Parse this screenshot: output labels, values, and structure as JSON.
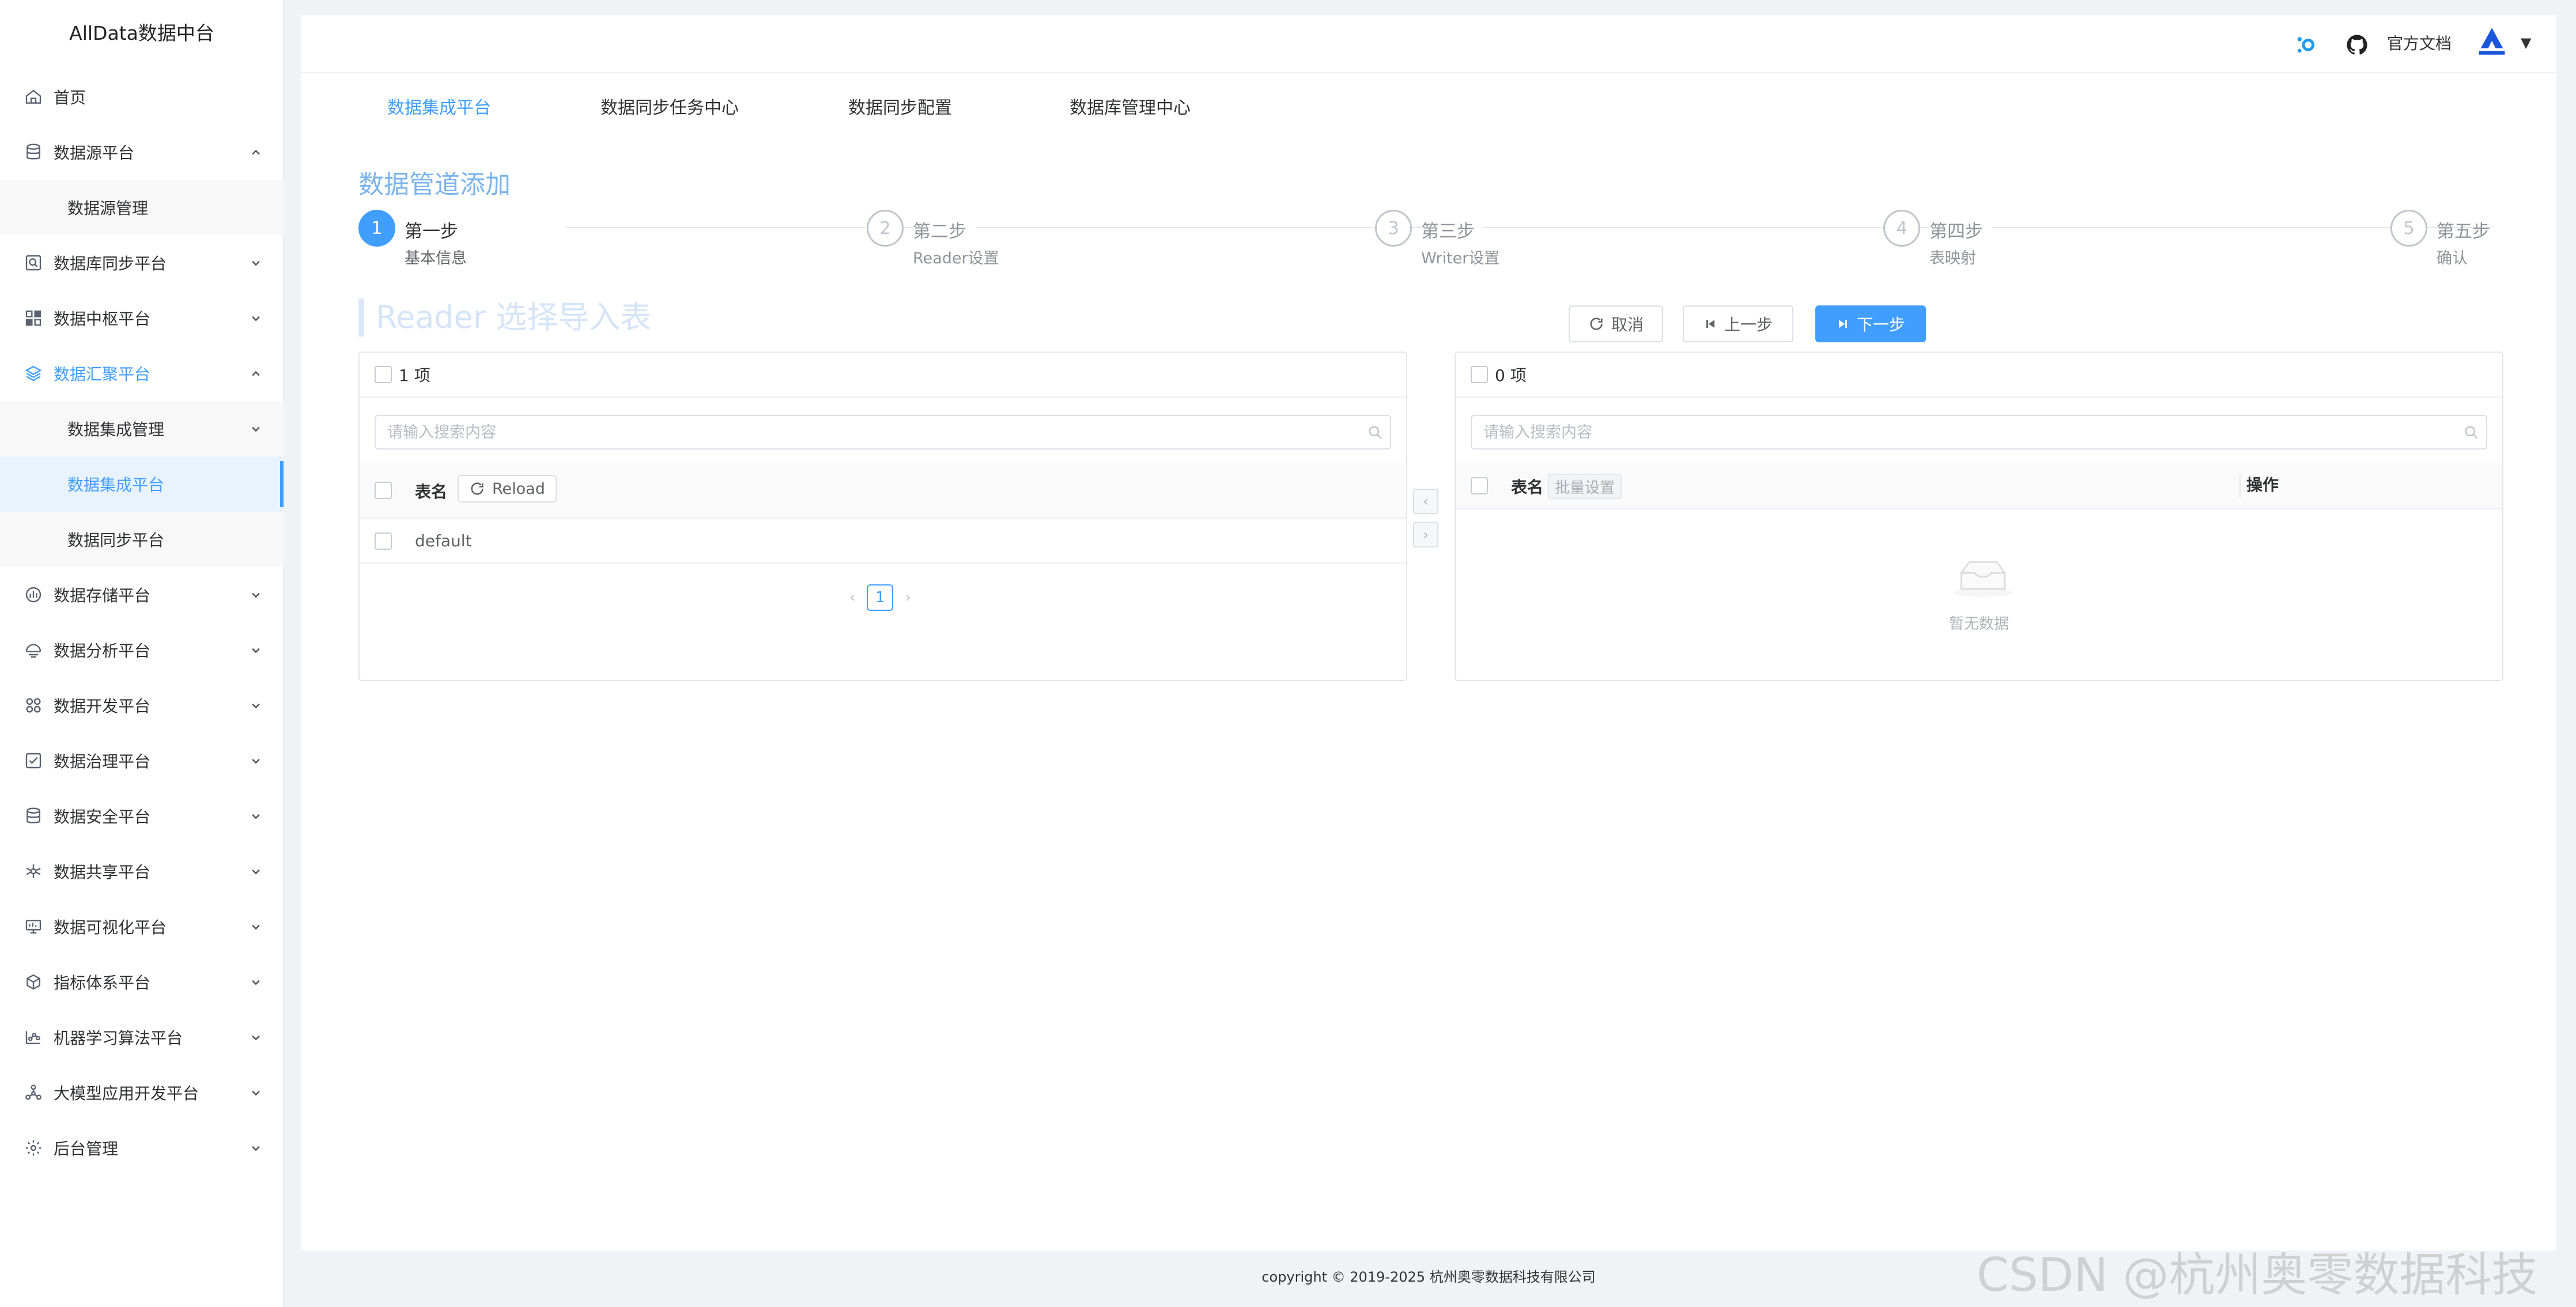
{
  "app": {
    "title": "AllData数据中台"
  },
  "sidebar": {
    "items": [
      {
        "label": "首页",
        "icon": "home-icon",
        "arrow": ""
      },
      {
        "label": "数据源平台",
        "icon": "database-icon",
        "arrow": "up"
      },
      {
        "label": "数据源管理",
        "sub": true
      },
      {
        "label": "数据库同步平台",
        "icon": "search-db-icon",
        "arrow": "down"
      },
      {
        "label": "数据中枢平台",
        "icon": "grid-icon",
        "arrow": "down"
      },
      {
        "label": "数据汇聚平台",
        "icon": "layers-icon",
        "arrow": "up",
        "highlight": true
      },
      {
        "label": "数据集成管理",
        "sub": true,
        "arrow": "down"
      },
      {
        "label": "数据集成平台",
        "sub": true,
        "active": true
      },
      {
        "label": "数据同步平台",
        "sub": true
      },
      {
        "label": "数据存储平台",
        "icon": "bar-chart-icon",
        "arrow": "down"
      },
      {
        "label": "数据分析平台",
        "icon": "analysis-icon",
        "arrow": "down"
      },
      {
        "label": "数据开发平台",
        "icon": "apps-icon",
        "arrow": "down"
      },
      {
        "label": "数据治理平台",
        "icon": "checklist-icon",
        "arrow": "down"
      },
      {
        "label": "数据安全平台",
        "icon": "shield-db-icon",
        "arrow": "down"
      },
      {
        "label": "数据共享平台",
        "icon": "share-icon",
        "arrow": "down"
      },
      {
        "label": "数据可视化平台",
        "icon": "monitor-icon",
        "arrow": "down"
      },
      {
        "label": "指标体系平台",
        "icon": "cube-icon",
        "arrow": "down"
      },
      {
        "label": "机器学习算法平台",
        "icon": "ml-icon",
        "arrow": "down"
      },
      {
        "label": "大模型应用开发平台",
        "icon": "network-icon",
        "arrow": "down"
      },
      {
        "label": "后台管理",
        "icon": "gear-icon",
        "arrow": "down"
      }
    ]
  },
  "header": {
    "docs_label": "官方文档"
  },
  "topnav": {
    "tabs": [
      {
        "label": "数据集成平台",
        "active": true
      },
      {
        "label": "数据同步任务中心"
      },
      {
        "label": "数据同步配置"
      },
      {
        "label": "数据库管理中心"
      }
    ]
  },
  "page": {
    "title": "数据管道添加",
    "section_title": "Reader 选择导入表"
  },
  "steps": [
    {
      "num": "1",
      "title": "第一步",
      "desc": "基本信息",
      "active": true
    },
    {
      "num": "2",
      "title": "第二步",
      "desc": "Reader设置"
    },
    {
      "num": "3",
      "title": "第三步",
      "desc": "Writer设置"
    },
    {
      "num": "4",
      "title": "第四步",
      "desc": "表映射"
    },
    {
      "num": "5",
      "title": "第五步",
      "desc": "确认"
    }
  ],
  "actions": {
    "cancel": "取消",
    "prev": "上一步",
    "next": "下一步"
  },
  "left_panel": {
    "count": "1 项",
    "search_placeholder": "请输入搜索内容",
    "col_name": "表名",
    "reload": "Reload",
    "rows": [
      "default"
    ],
    "page": "1"
  },
  "right_panel": {
    "count": "0 项",
    "search_placeholder": "请输入搜索内容",
    "col_name": "表名",
    "batch": "批量设置",
    "col_op": "操作",
    "empty": "暂无数据"
  },
  "footer": {
    "text": "copyright © 2019-2025 杭州奥零数据科技有限公司"
  },
  "watermark": "CSDN @杭州奥零数据科技",
  "colors": {
    "primary": "#409eff",
    "sidebar_bg": "#ffffff",
    "page_bg": "#f0f2f5"
  }
}
